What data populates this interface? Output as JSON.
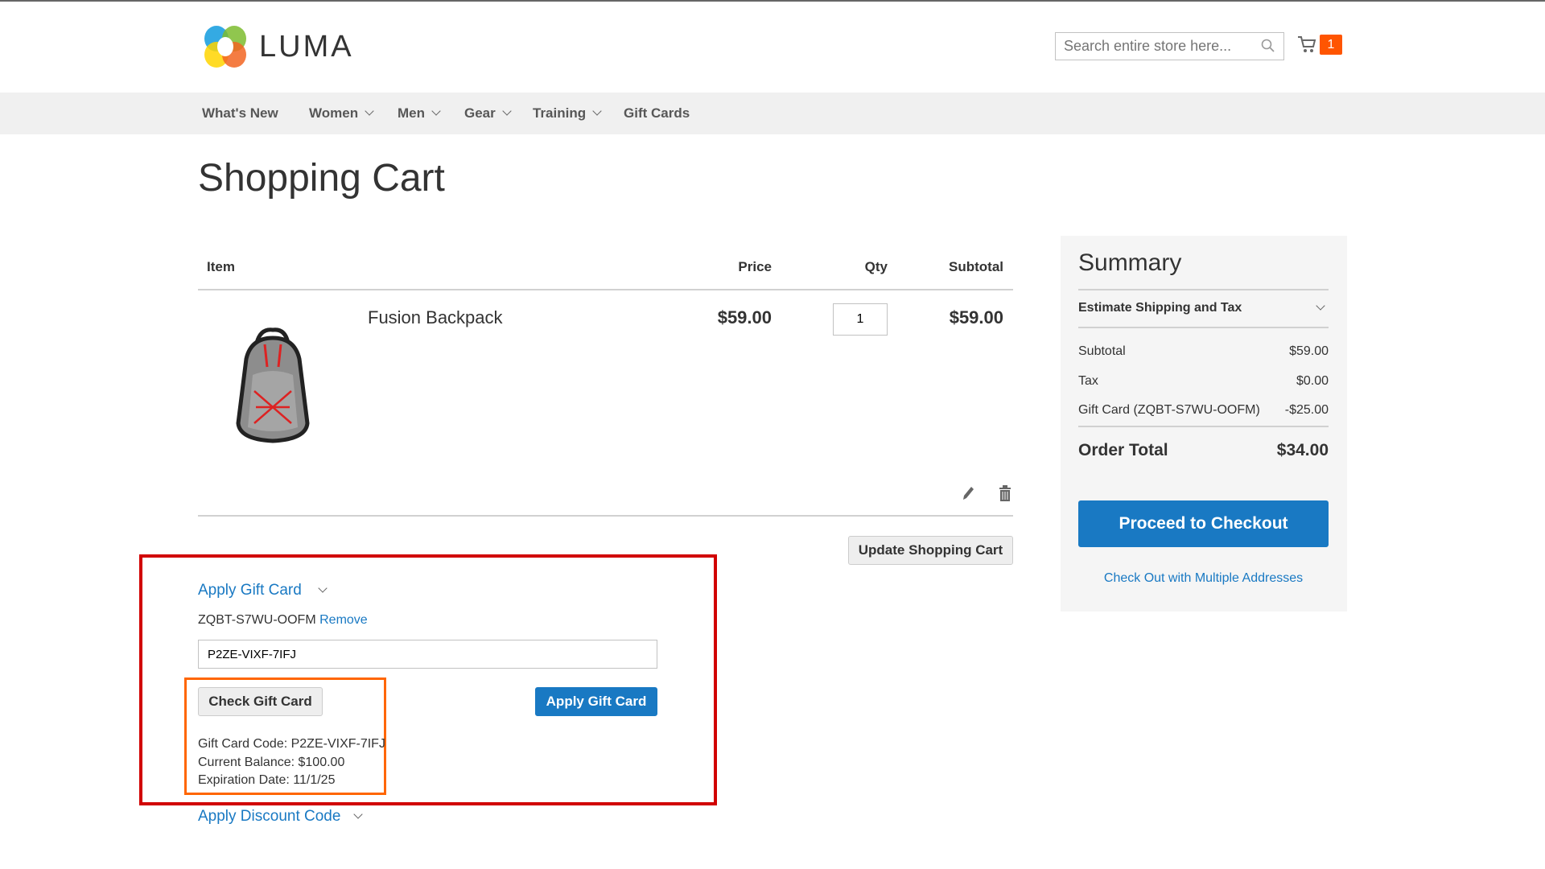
{
  "header": {
    "logo_text": "LUMA",
    "search_placeholder": "Search entire store here...",
    "cart_count": "1"
  },
  "nav": {
    "items": [
      {
        "label": "What's New"
      },
      {
        "label": "Women"
      },
      {
        "label": "Men"
      },
      {
        "label": "Gear"
      },
      {
        "label": "Training"
      },
      {
        "label": "Gift Cards"
      }
    ]
  },
  "page": {
    "title": "Shopping Cart"
  },
  "cart": {
    "columns": [
      "Item",
      "Price",
      "Qty",
      "Subtotal"
    ],
    "items": [
      {
        "name": "Fusion Backpack",
        "price": "$59.00",
        "qty": "1",
        "subtotal": "$59.00"
      }
    ],
    "update_label": "Update Shopping Cart"
  },
  "gift_card": {
    "toggle_label": "Apply Gift Card",
    "applied_code": "ZQBT-S7WU-OOFM",
    "remove_label": "Remove",
    "input_value": "P2ZE-VIXF-7IFJ",
    "check_label": "Check Gift Card",
    "apply_label": "Apply Gift Card",
    "info": [
      "Gift Card Code: P2ZE-VIXF-7IFJ",
      "Current Balance: $100.00",
      "Expiration Date: 11/1/25"
    ]
  },
  "discount": {
    "toggle_label": "Apply Discount Code"
  },
  "summary": {
    "title": "Summary",
    "estimate_label": "Estimate Shipping and Tax",
    "rows": [
      {
        "label": "Subtotal",
        "value": "$59.00"
      },
      {
        "label": "Tax",
        "value": "$0.00"
      },
      {
        "label": "Gift Card (ZQBT-S7WU-OOFM)",
        "value": "-$25.00"
      }
    ],
    "total_label": "Order Total",
    "total_value": "$34.00",
    "checkout_label": "Proceed to Checkout",
    "multi_label": "Check Out with Multiple Addresses"
  },
  "colors": {
    "accent": "#1979c3",
    "badge": "#ff5501",
    "highlight_red": "#d10000",
    "highlight_orange": "#ff6600"
  }
}
